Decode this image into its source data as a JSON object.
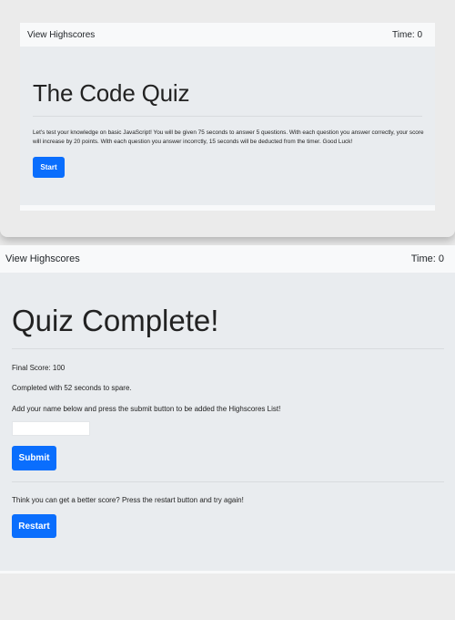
{
  "screen1": {
    "nav": {
      "highscores_link": "View Highscores",
      "timer": "Time: 0"
    },
    "title": "The Code Quiz",
    "intro": "Let's test your knowledge on basic JavaScript! You will be given 75 seconds to answer 5 questions. With each question you answer correctly, your score will increase by 20 points. With each question you answer incorrctly, 15 seconds will be deducted from the timer. Good Luck!",
    "start_label": "Start"
  },
  "screen2": {
    "nav": {
      "highscores_link": "View Highscores",
      "timer": "Time: 0"
    },
    "title": "Quiz Complete!",
    "final_score": "Final Score: 100",
    "completed_text": "Completed with 52 seconds to spare.",
    "instructions": "Add your name below and press the submit button to be added the Highscores List!",
    "name_input": {
      "value": "",
      "placeholder": ""
    },
    "submit_label": "Submit",
    "retry_text": "Think you can get a better score? Press the restart button and try again!",
    "restart_label": "Restart"
  }
}
